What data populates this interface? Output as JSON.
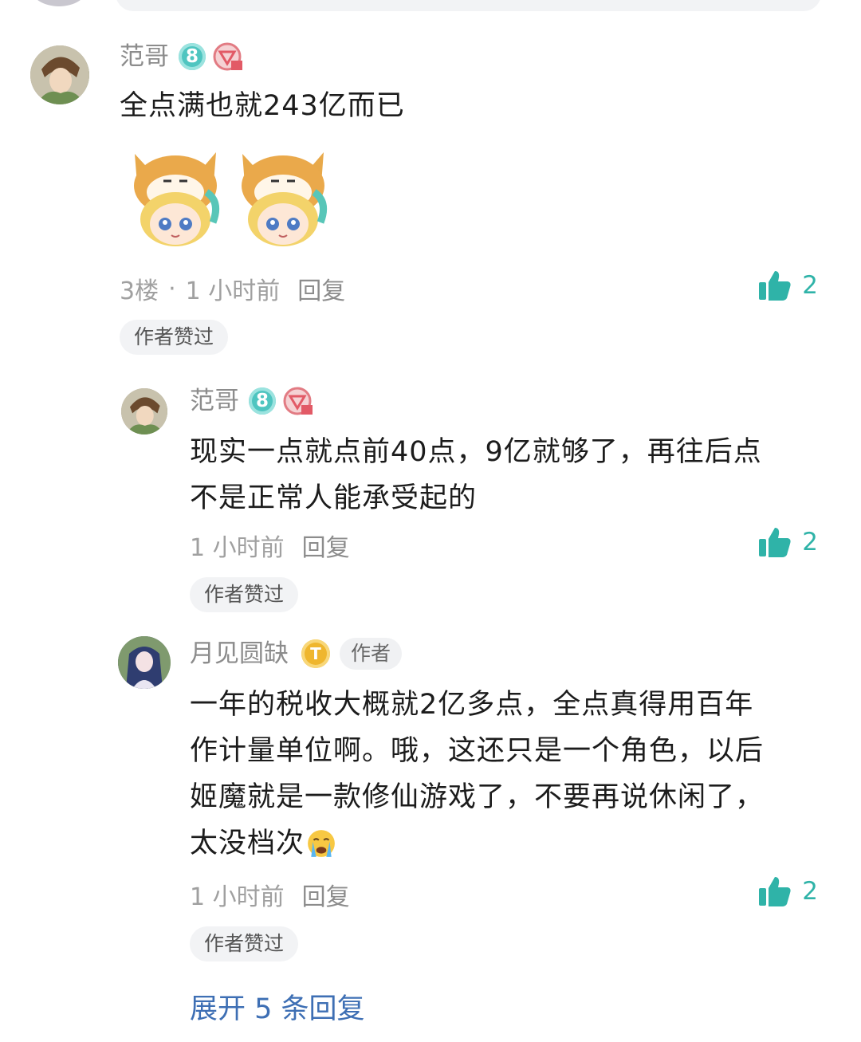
{
  "colors": {
    "accent": "#2fb3a8",
    "expand_link": "#3e6fb4",
    "level_badge": "#4fc5c0",
    "t_badge": "#efb62e"
  },
  "comment_main": {
    "username": "范哥",
    "level": "8",
    "text": "全点满也就243亿而已",
    "floor": "3楼",
    "separator": "·",
    "time": "1 小时前",
    "reply_label": "回复",
    "likes": "2",
    "author_liked": "作者赞过",
    "stickers": [
      "shiba-hood-girl-sticker",
      "shiba-hood-girl-sticker"
    ]
  },
  "replies": [
    {
      "username": "范哥",
      "level": "8",
      "text_lines": [
        "现实一点就点前40点，9亿就够了，再往后点",
        "不是正常人能承受起的"
      ],
      "time": "1 小时前",
      "reply_label": "回复",
      "likes": "2",
      "author_liked": "作者赞过"
    },
    {
      "username": "月见圆缺",
      "badge": "T",
      "author_tag": "作者",
      "text_lines": [
        "一年的税收大概就2亿多点，全点真得用百年",
        "作计量单位啊。哦，这还只是一个角色，以后",
        "姬魔就是一款修仙游戏了，不要再说休闲了，",
        "太没档次"
      ],
      "emoji": "crying-face-emoji",
      "time": "1 小时前",
      "reply_label": "回复",
      "likes": "2",
      "author_liked": "作者赞过"
    }
  ],
  "expand_label": "展开 5 条回复"
}
